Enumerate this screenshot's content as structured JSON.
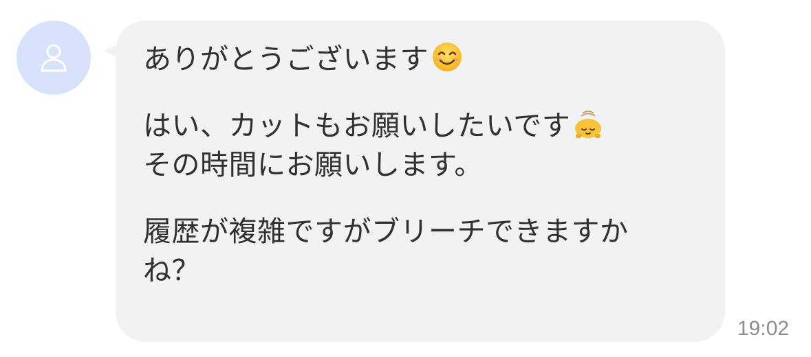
{
  "chat": {
    "message": {
      "line1": "ありがとうございます",
      "line2": "はい、カットもお願いしたいです",
      "line3": "その時間にお願いします。",
      "line4": "履歴が複雑ですがブリーチできますか",
      "line5": "ね？"
    },
    "timestamp": "19:02",
    "avatar_icon": "person-icon",
    "emoji_1": "smiling-face-emoji",
    "emoji_2": "bowing-face-emoji"
  },
  "colors": {
    "avatar_bg": "#d7e3fa",
    "bubble_bg": "#f1f2f4",
    "text": "#2f3034",
    "timestamp": "#8b8d93"
  }
}
